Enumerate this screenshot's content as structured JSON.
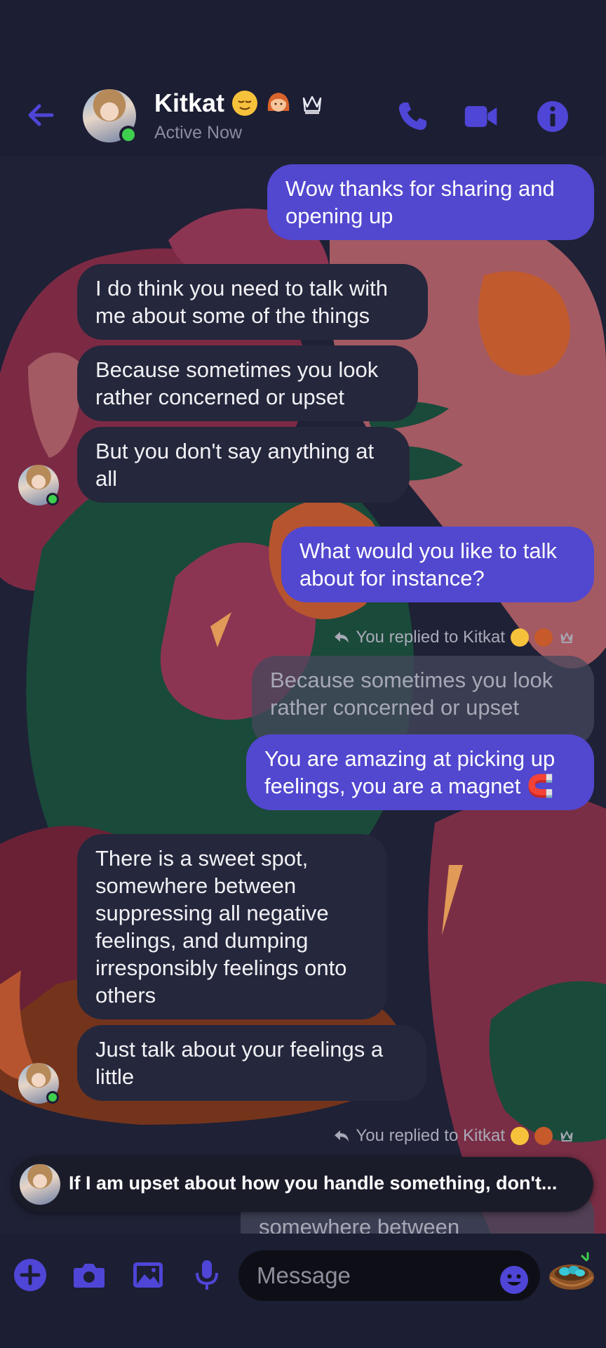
{
  "header": {
    "contact_name": "Kitkat",
    "status": "Active Now",
    "name_emojis": [
      "relieved-face-emoji",
      "woman-emoji",
      "crown-icon"
    ],
    "icons": [
      "back-arrow-icon",
      "phone-icon",
      "video-camera-icon",
      "info-icon"
    ]
  },
  "messages": [
    {
      "side": "out",
      "text": "Wow thanks for sharing and opening up"
    },
    {
      "side": "in",
      "text": "I do think you need to talk with me about some of the things"
    },
    {
      "side": "in",
      "text": "Because sometimes you look rather concerned or upset"
    },
    {
      "side": "in",
      "text": "But you don't say anything at all"
    },
    {
      "side": "out",
      "text": "What would you like to talk about for instance?"
    },
    {
      "side": "note",
      "text": "You replied to Kitkat"
    },
    {
      "side": "quoted",
      "text": "Because sometimes you look rather concerned or upset"
    },
    {
      "side": "out",
      "text": "You are amazing at picking up feelings, you are a magnet 🧲"
    },
    {
      "side": "in",
      "text": "There is a sweet spot, somewhere between suppressing all negative feelings, and dumping irresponsibly feelings onto others"
    },
    {
      "side": "in",
      "text": "Just talk about your feelings a little"
    },
    {
      "side": "note",
      "text": "You replied to Kitkat"
    },
    {
      "side": "quoted",
      "text": "somewhere between suppressing all negative feeli"
    }
  ],
  "pinned": {
    "text": "If I am upset about how you handle something, don't..."
  },
  "composer": {
    "placeholder": "Message",
    "icons": [
      "plus-icon",
      "camera-icon",
      "image-icon",
      "microphone-icon",
      "emoji-icon",
      "nest-sticker-icon"
    ]
  },
  "colors": {
    "accent": "#5247cf",
    "icon": "#4f45d6",
    "incoming_bubble": "#25273c",
    "online": "#3fcf4e",
    "background": "#1c1e33"
  }
}
